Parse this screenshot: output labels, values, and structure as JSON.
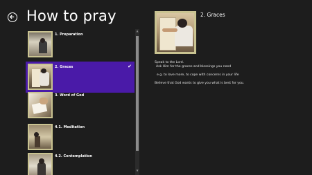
{
  "header": {
    "title": "How to pray"
  },
  "list": {
    "items": [
      {
        "label": "1. Preparation",
        "selected": false
      },
      {
        "label": "2. Graces",
        "selected": true
      },
      {
        "label": "3. Word of God",
        "selected": false
      },
      {
        "label": "4.1. Meditation",
        "selected": false
      },
      {
        "label": "4.2. Contemplation",
        "selected": false
      }
    ],
    "check_glyph": "✔"
  },
  "scrollbar": {
    "up_glyph": "▲",
    "down_glyph": "▼"
  },
  "detail": {
    "title": "2. Graces",
    "lines": [
      "Speak to the Lord.",
      "Ask Him for the graces and blessings you need",
      "e.g. to love more,  to cope with concerns in your life",
      "Believe that God wants to give you what is best for you."
    ]
  },
  "colors": {
    "background": "#1d1d1d",
    "selected": "#4a1aa8",
    "thumb_border": "#c9c391"
  },
  "icons": {
    "back": "back-arrow-icon"
  }
}
